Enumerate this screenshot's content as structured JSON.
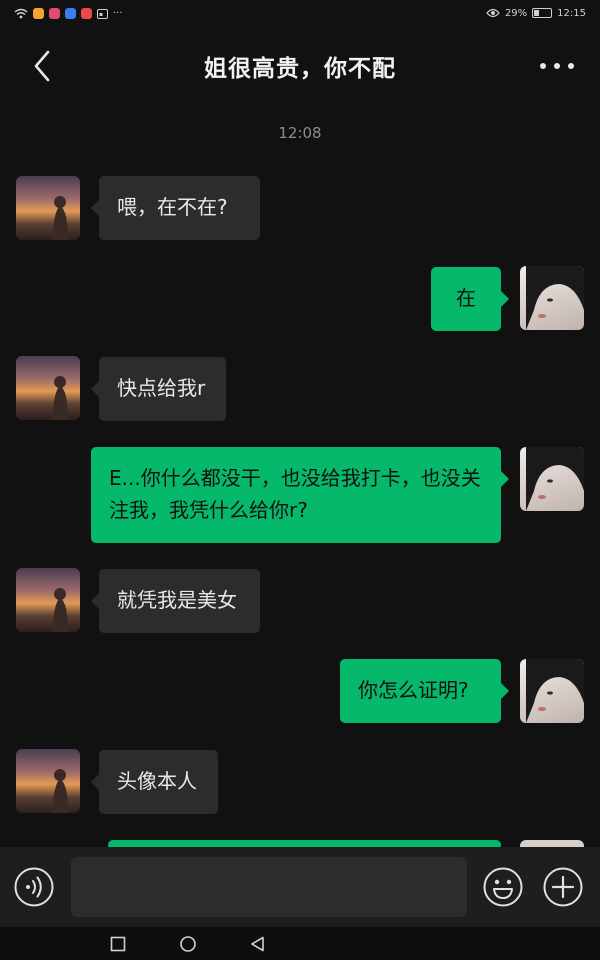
{
  "status_bar": {
    "battery_percent": "29%",
    "battery_level": 0.29,
    "time": "12:15",
    "more_indicator": "···",
    "app_icon_colors": [
      "#f4a531",
      "#e24b6a",
      "#3b7cf0",
      "#e84a4a"
    ]
  },
  "header": {
    "title": "姐很高贵，你不配"
  },
  "timestamp": "12:08",
  "messages": [
    {
      "side": "in",
      "text": "喂，在不在?"
    },
    {
      "side": "out",
      "text": "在"
    },
    {
      "side": "in",
      "text": "快点给我r"
    },
    {
      "side": "out",
      "text": "E...你什么都没干，也没给我打卡，也没关注我，我凭什么给你r?"
    },
    {
      "side": "in",
      "text": "就凭我是美女"
    },
    {
      "side": "out",
      "text": "你怎么证明?"
    },
    {
      "side": "in",
      "text": "头像本人"
    }
  ],
  "input_bar": {
    "placeholder": ""
  },
  "colors": {
    "background": "#111111",
    "incoming_bubble": "#2c2c2c",
    "outgoing_bubble": "#05b86a"
  }
}
